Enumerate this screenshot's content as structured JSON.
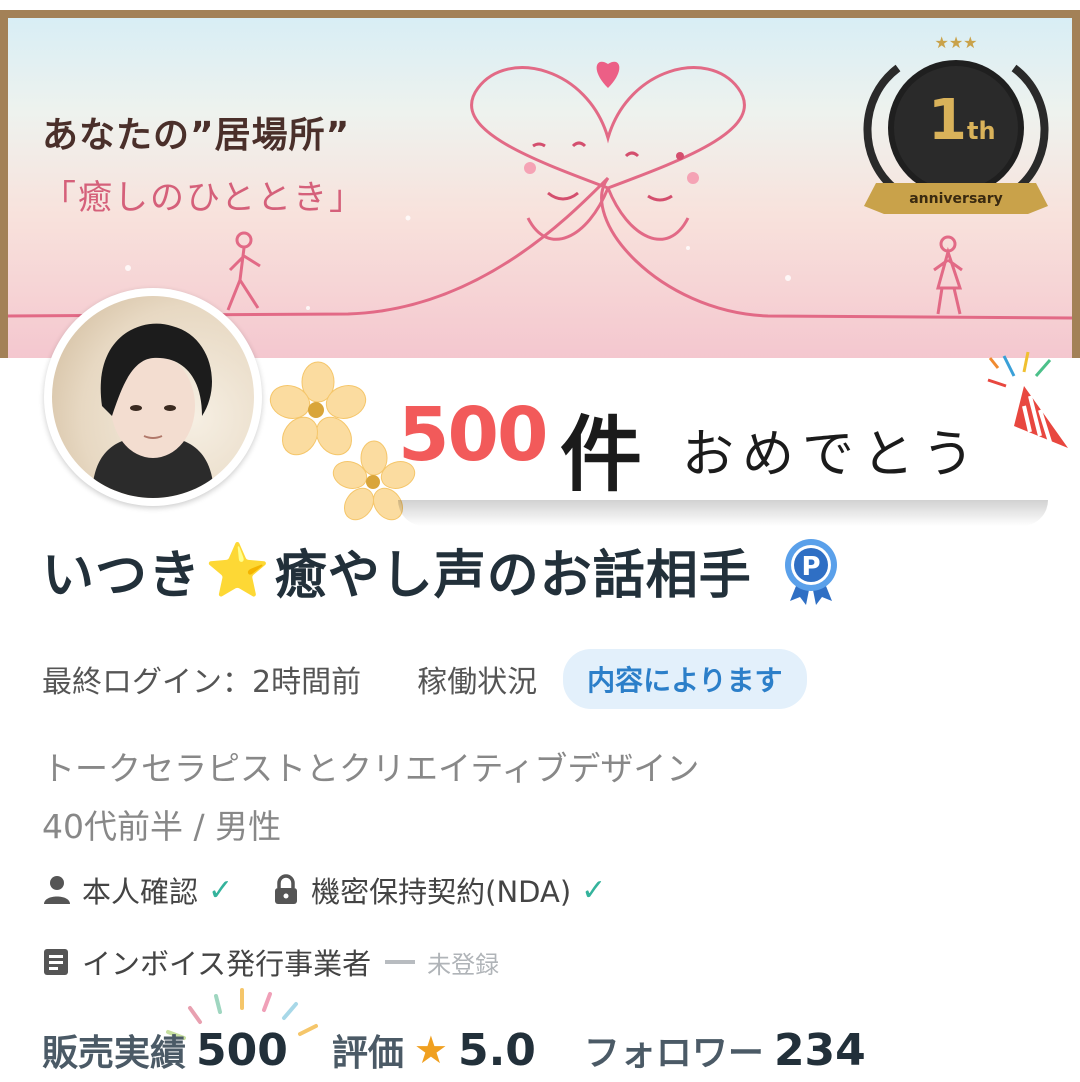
{
  "banner": {
    "title": "あなたの”居場所”",
    "subtitle": "「癒しのひととき」",
    "badge_number": "1",
    "badge_suffix": "th",
    "badge_text": "anniversary"
  },
  "celebration": {
    "count": "500",
    "unit": "件",
    "message": "おめでとう"
  },
  "profile": {
    "name_part1": "いつき",
    "name_star": "⭐",
    "name_part2": "癒やし声のお話相手",
    "badge_letter": "P",
    "last_login_label": "最終ログイン：",
    "last_login_value": "2時間前",
    "status_label": "稼働状況",
    "status_value": "内容によります",
    "occupation": "トークセラピストとクリエイティブデザイン",
    "age_gender": "40代前半 / 男性",
    "identity_label": "本人確認",
    "nda_label": "機密保持契約(NDA)",
    "invoice_label": "インボイス発行事業者",
    "invoice_status": "未登録"
  },
  "stats": {
    "sales_label": "販売実績",
    "sales_value": "500",
    "rating_label": "評価",
    "rating_value": "5.0",
    "followers_label": "フォロワー",
    "followers_value": "234"
  },
  "colors": {
    "accent": "#2c7fc9",
    "check": "#34b39c",
    "celebrate_number": "#f25a5a",
    "star": "#f0a020"
  }
}
